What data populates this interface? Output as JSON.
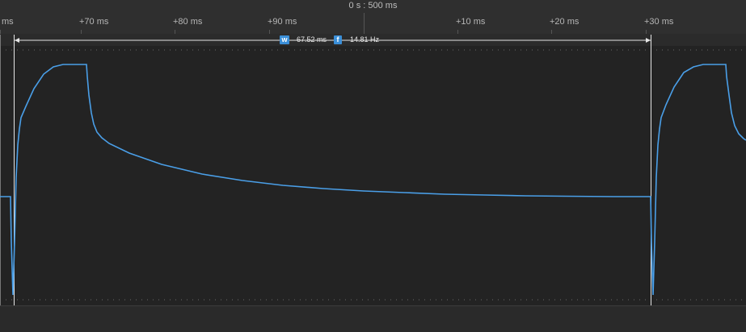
{
  "header": {
    "absolute_time": "0 s : 500 ms",
    "ticks": [
      {
        "label": "ms"
      },
      {
        "label": "+70 ms"
      },
      {
        "label": "+80 ms"
      },
      {
        "label": "+90 ms"
      },
      {
        "label": "+10 ms"
      },
      {
        "label": "+20 ms"
      },
      {
        "label": "+30 ms"
      }
    ]
  },
  "measurement": {
    "width_icon": "w",
    "width_value": "67.52 ms",
    "freq_icon": "f",
    "freq_value": "14.81 Hz"
  },
  "colors": {
    "trace": "#4a9fe8",
    "badge": "#3b8fd8",
    "background": "#232323"
  }
}
